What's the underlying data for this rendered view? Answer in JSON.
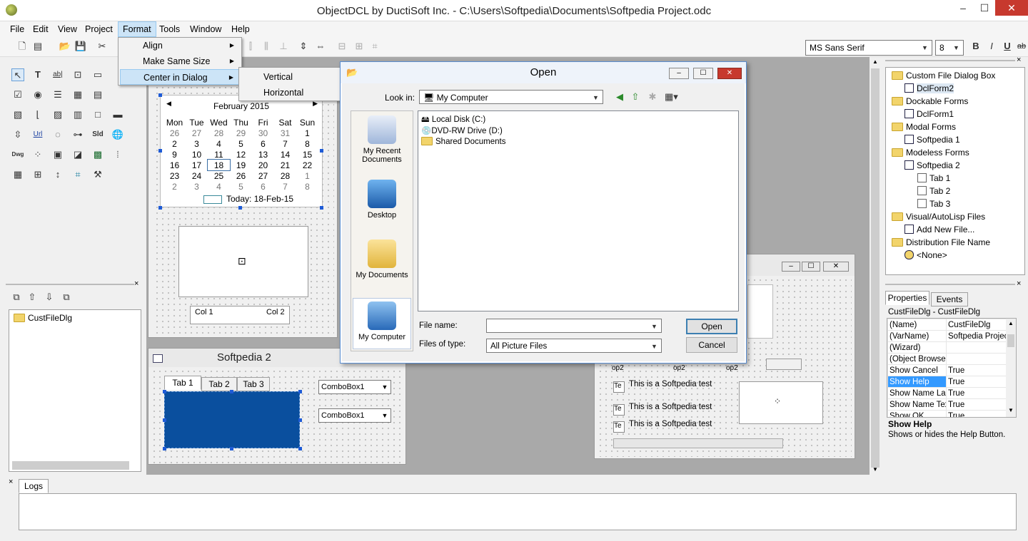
{
  "window": {
    "title": "ObjectDCL by DuctiSoft Inc. - C:\\Users\\Softpedia\\Documents\\Softpedia Project.odc",
    "minimize": "–",
    "maximize": "☐",
    "close": "✕"
  },
  "menu": [
    "File",
    "Edit",
    "View",
    "Project",
    "Format",
    "Tools",
    "Window",
    "Help"
  ],
  "format_menu": {
    "items": [
      "Align",
      "Make Same Size",
      "Center in Dialog"
    ],
    "submenu": [
      "Vertical",
      "Horizontal"
    ]
  },
  "font": {
    "name": "MS Sans Serif",
    "size": "8",
    "bold": "B",
    "italic": "I",
    "underline": "U",
    "strike": "ab"
  },
  "toolbox_icons": [
    "T",
    "ab|",
    "Url",
    "Sld",
    "Dwg"
  ],
  "calendar": {
    "title": "February 2015",
    "days": [
      "Mon",
      "Tue",
      "Wed",
      "Thu",
      "Fri",
      "Sat",
      "Sun"
    ],
    "weeks": [
      [
        "26",
        "27",
        "28",
        "29",
        "30",
        "31",
        "1"
      ],
      [
        "2",
        "3",
        "4",
        "5",
        "6",
        "7",
        "8"
      ],
      [
        "9",
        "10",
        "11",
        "12",
        "13",
        "14",
        "15"
      ],
      [
        "16",
        "17",
        "18",
        "19",
        "20",
        "21",
        "22"
      ],
      [
        "23",
        "24",
        "25",
        "26",
        "27",
        "28",
        "1"
      ],
      [
        "2",
        "3",
        "4",
        "5",
        "6",
        "7",
        "8"
      ]
    ],
    "today": "Today: 18-Feb-15"
  },
  "list_columns": [
    "Col 1",
    "Col 2"
  ],
  "project_tree": {
    "item": "CustFileDlg"
  },
  "form_softpedia2": {
    "title": "Softpedia 2",
    "tabs": [
      "Tab 1",
      "Tab 2",
      "Tab 3"
    ],
    "combo1": "ComboBox1",
    "combo2": "ComboBox1"
  },
  "modeless": {
    "texts": [
      "This is a Softpedia test",
      "This is a Softpedia test",
      "This is a Softpedia test"
    ],
    "te": "Te",
    "op": "op2"
  },
  "open_dialog": {
    "title": "Open",
    "look_in_label": "Look in:",
    "look_in_value": "My Computer",
    "places": [
      "My Recent Documents",
      "Desktop",
      "My Documents",
      "My Computer"
    ],
    "files": [
      "Local Disk (C:)",
      "DVD-RW Drive (D:)",
      "Shared Documents"
    ],
    "file_name_label": "File name:",
    "file_name_value": "",
    "file_type_label": "Files of type:",
    "file_type_value": "All Picture Files",
    "open_btn": "Open",
    "cancel_btn": "Cancel"
  },
  "dialog_tree": [
    {
      "label": "Custom File Dialog Box",
      "level": 0,
      "kind": "folder"
    },
    {
      "label": "DclForm2",
      "level": 1,
      "kind": "form",
      "selected": true
    },
    {
      "label": "Dockable Forms",
      "level": 0,
      "kind": "folder"
    },
    {
      "label": "DclForm1",
      "level": 1,
      "kind": "form"
    },
    {
      "label": "Modal Forms",
      "level": 0,
      "kind": "folder"
    },
    {
      "label": "Softpedia 1",
      "level": 1,
      "kind": "form"
    },
    {
      "label": "Modeless Forms",
      "level": 0,
      "kind": "folder"
    },
    {
      "label": "Softpedia 2",
      "level": 1,
      "kind": "form"
    },
    {
      "label": "Tab 1",
      "level": 2,
      "kind": "page"
    },
    {
      "label": "Tab 2",
      "level": 2,
      "kind": "page"
    },
    {
      "label": "Tab 3",
      "level": 2,
      "kind": "page"
    },
    {
      "label": "Visual/AutoLisp Files",
      "level": 0,
      "kind": "folder"
    },
    {
      "label": "Add New File...",
      "level": 1,
      "kind": "file"
    },
    {
      "label": "Distribution File Name",
      "level": 0,
      "kind": "folder"
    },
    {
      "label": "<None>",
      "level": 1,
      "kind": "key"
    }
  ],
  "properties": {
    "tabs": [
      "Properties",
      "Events"
    ],
    "object": "CustFileDlg - CustFileDlg",
    "rows": [
      [
        "(Name)",
        "CustFileDlg"
      ],
      [
        "(VarName)",
        "Softpedia Projec"
      ],
      [
        "(Wizard)",
        ""
      ],
      [
        "(Object Browser)",
        ""
      ],
      [
        "Show Cancel",
        "True"
      ],
      [
        "Show Help",
        "True"
      ],
      [
        "Show Name Lab",
        "True"
      ],
      [
        "Show Name Tex",
        "True"
      ],
      [
        "Show OK",
        "True"
      ]
    ],
    "help_title": "Show Help",
    "help_text": "Shows or hides the Help Button."
  },
  "logs": {
    "tab": "Logs"
  }
}
